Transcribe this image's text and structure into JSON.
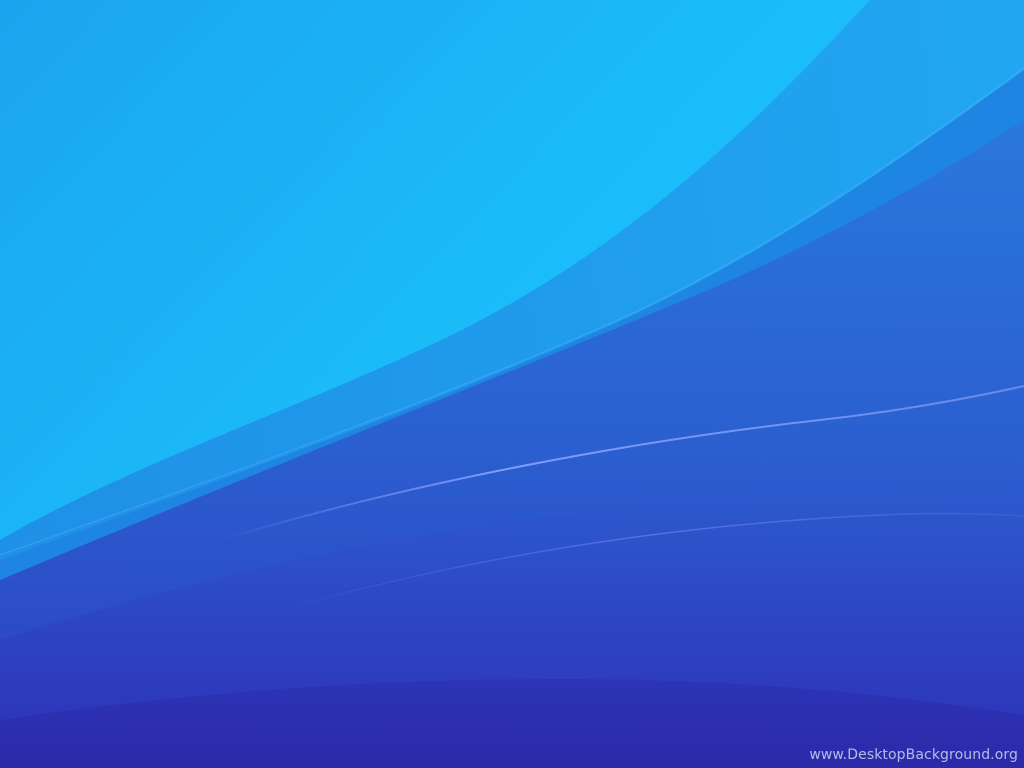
{
  "wallpaper": {
    "description_colors": {
      "sky_top": "#19c0fb",
      "sky_left": "#1ca6ef",
      "band_mid": "#1f8ee6",
      "deep_blue": "#2b3fc2",
      "deep_indigo": "#2d2aae",
      "highlight_line": "#8aa4ff"
    }
  },
  "watermark": {
    "text": "www.DesktopBackground.org"
  }
}
